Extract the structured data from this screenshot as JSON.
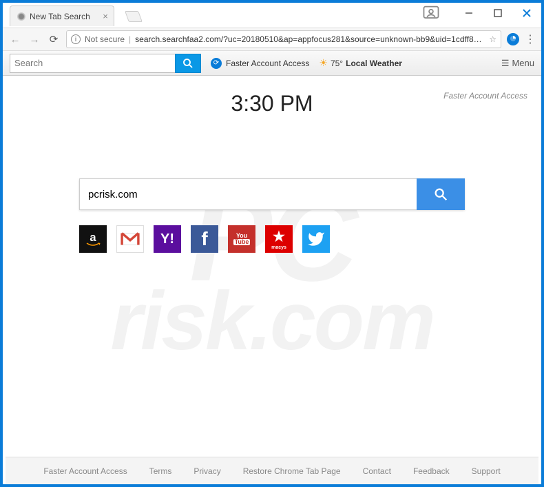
{
  "browser": {
    "tab_title": "New Tab Search",
    "not_secure_label": "Not secure",
    "url_display": "search.searchfaa2.com/?uc=20180510&ap=appfocus281&source=unknown-bb9&uid=1cdff8a..."
  },
  "toolbar": {
    "search_placeholder": "Search",
    "faa_link": "Faster Account Access",
    "weather_temp": "75°",
    "weather_label": "Local Weather",
    "menu_label": "Menu"
  },
  "page": {
    "brand": "Faster Account Access",
    "clock": "3:30 PM",
    "main_search_value": "pcrisk.com"
  },
  "quick_links": {
    "amazon": "amazon-icon",
    "gmail": "gmail-icon",
    "yahoo": "yahoo-icon",
    "facebook": "facebook-icon",
    "youtube": "youtube-icon",
    "macys": "macys-icon",
    "twitter": "twitter-icon"
  },
  "footer": {
    "items": [
      "Faster Account Access",
      "Terms",
      "Privacy",
      "Restore Chrome Tab Page",
      "Contact",
      "Feedback",
      "Support"
    ]
  }
}
